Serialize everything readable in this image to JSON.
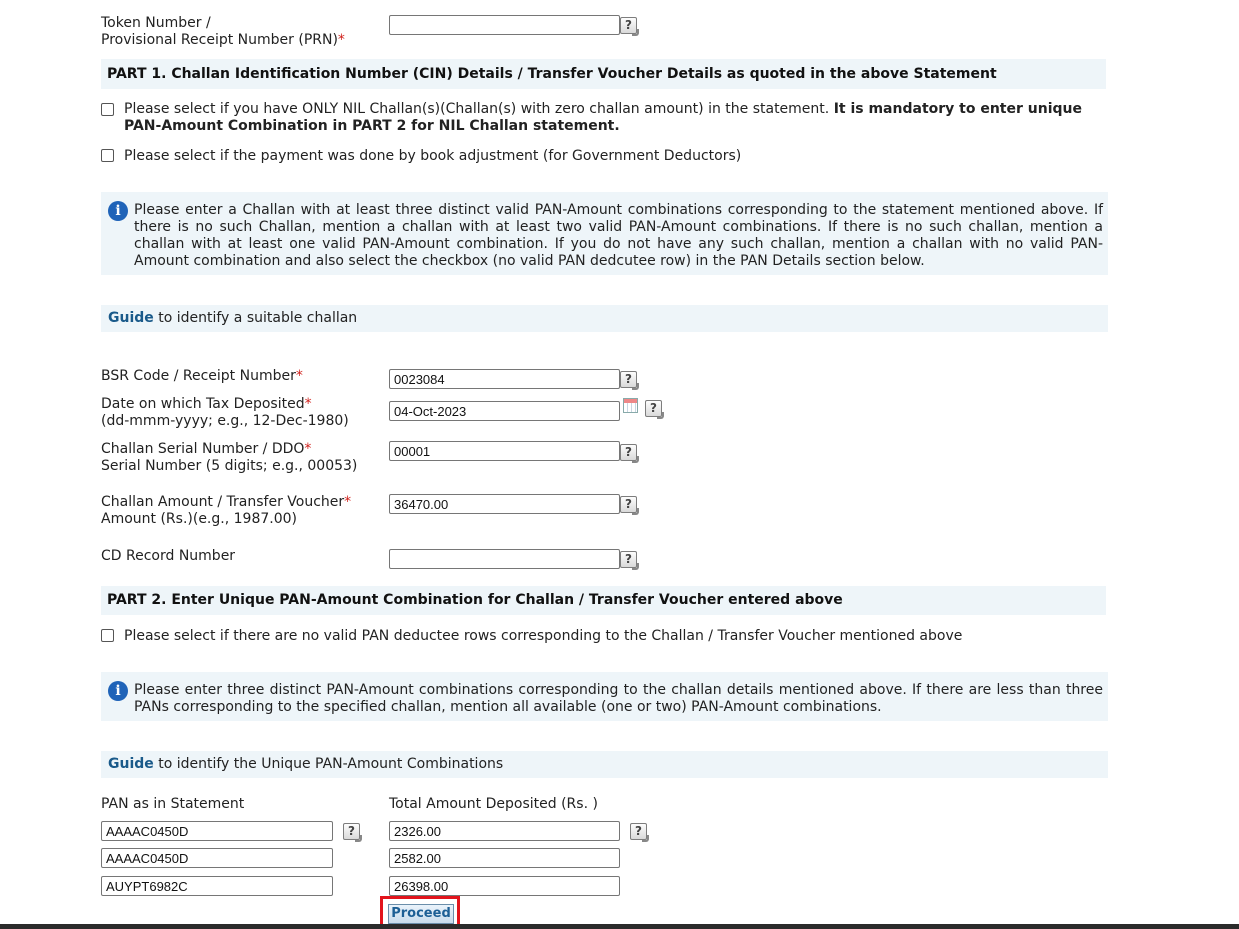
{
  "token": {
    "label_line1": "Token Number /",
    "label_line2": "Provisional Receipt Number (PRN)",
    "required_mark": "*",
    "value": "",
    "help": "?"
  },
  "part1": {
    "heading": "PART 1. Challan Identification Number (CIN) Details / Transfer Voucher Details as quoted in the above Statement",
    "nil_checkbox_text": "Please select if you have ONLY NIL Challan(s)(Challan(s) with zero challan amount) in the statement.",
    "nil_checkbox_bold_a": "It is mandatory to enter unique",
    "nil_checkbox_bold_b": "PAN-Amount Combination in PART 2 for NIL Challan statement.",
    "book_adj_text": "Please select if the payment was done by book adjustment (for Government Deductors)",
    "info_icon": "i",
    "info_text": "Please enter a Challan with at least three distinct valid PAN-Amount combinations corresponding to the statement mentioned above. If there is no such Challan, mention a challan with at least two valid PAN-Amount combinations. If there is no such challan, mention a challan with at least one valid PAN-Amount combination. If you do not have any such challan, mention a challan with no valid PAN-Amount combination and also select the checkbox (no valid PAN dedcutee row) in the PAN Details section below.",
    "guide_link": "Guide",
    "guide_text": " to identify a suitable challan"
  },
  "fields": {
    "bsr_label": "BSR Code / Receipt Number",
    "bsr_value": "0023084",
    "date_label_line1": "Date on which Tax Deposited",
    "date_label_line2": "(dd-mmm-yyyy; e.g., 12-Dec-1980)",
    "date_value": "04-Oct-2023",
    "serial_label_line1": "Challan Serial Number / DDO",
    "serial_label_line2": "Serial Number (5 digits; e.g., 00053)",
    "serial_value": "00001",
    "amount_label_line1": "Challan Amount / Transfer Voucher",
    "amount_label_line2": "Amount (Rs.)(e.g., 1987.00)",
    "amount_value": "36470.00",
    "cd_label": "CD Record Number",
    "cd_value": "",
    "required_mark": "*",
    "help": "?"
  },
  "part2": {
    "heading": "PART 2. Enter Unique PAN-Amount Combination for Challan / Transfer Voucher entered above",
    "no_pan_checkbox_text": "Please select if there are no valid PAN deductee rows corresponding to the Challan / Transfer Voucher mentioned above",
    "info_icon": "i",
    "info_text": "Please enter three distinct PAN-Amount combinations corresponding to the challan details mentioned above. If there are less than three PANs corresponding to the specified challan, mention all available (one or two) PAN-Amount combinations.",
    "guide_link": "Guide",
    "guide_text": " to identify the Unique PAN-Amount Combinations",
    "pan_header": "PAN as in Statement",
    "amount_header": "Total Amount Deposited (Rs. )",
    "rows": [
      {
        "pan": "AAAAC0450D",
        "amount": "2326.00"
      },
      {
        "pan": "AAAAC0450D",
        "amount": "2582.00"
      },
      {
        "pan": "AUYPT6982C",
        "amount": "26398.00"
      }
    ],
    "help": "?"
  },
  "actions": {
    "proceed_label": "Proceed"
  }
}
